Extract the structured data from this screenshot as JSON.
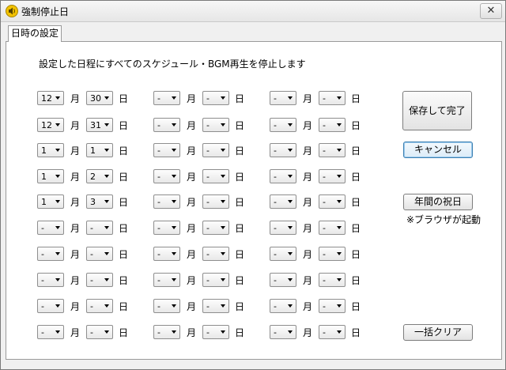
{
  "window": {
    "title": "強制停止日",
    "close_glyph": "✕"
  },
  "tab": {
    "label": "日時の設定"
  },
  "description": "設定した日程にすべてのスケジュール・BGM再生を停止します",
  "labels": {
    "month": "月",
    "day": "日"
  },
  "rows": [
    [
      [
        "12",
        "30"
      ],
      [
        "-",
        "-"
      ],
      [
        "-",
        "-"
      ]
    ],
    [
      [
        "12",
        "31"
      ],
      [
        "-",
        "-"
      ],
      [
        "-",
        "-"
      ]
    ],
    [
      [
        "1",
        "1"
      ],
      [
        "-",
        "-"
      ],
      [
        "-",
        "-"
      ]
    ],
    [
      [
        "1",
        "2"
      ],
      [
        "-",
        "-"
      ],
      [
        "-",
        "-"
      ]
    ],
    [
      [
        "1",
        "3"
      ],
      [
        "-",
        "-"
      ],
      [
        "-",
        "-"
      ]
    ],
    [
      [
        "-",
        "-"
      ],
      [
        "-",
        "-"
      ],
      [
        "-",
        "-"
      ]
    ],
    [
      [
        "-",
        "-"
      ],
      [
        "-",
        "-"
      ],
      [
        "-",
        "-"
      ]
    ],
    [
      [
        "-",
        "-"
      ],
      [
        "-",
        "-"
      ],
      [
        "-",
        "-"
      ]
    ],
    [
      [
        "-",
        "-"
      ],
      [
        "-",
        "-"
      ],
      [
        "-",
        "-"
      ]
    ],
    [
      [
        "-",
        "-"
      ],
      [
        "-",
        "-"
      ],
      [
        "-",
        "-"
      ]
    ]
  ],
  "buttons": {
    "save": "保存して完了",
    "cancel": "キャンセル",
    "holidays": "年間の祝日",
    "clear": "一括クリア"
  },
  "note": "※ブラウザが起動"
}
